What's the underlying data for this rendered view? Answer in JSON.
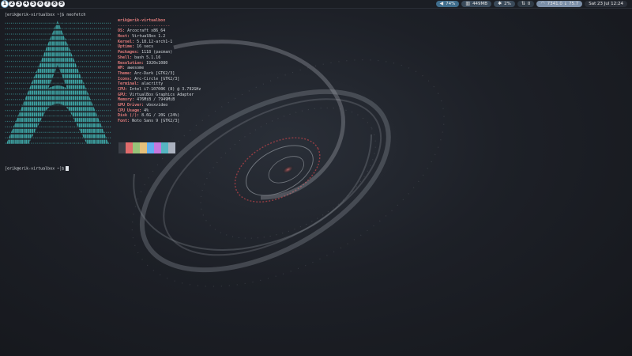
{
  "topbar": {
    "workspaces": [
      "1",
      "2",
      "3",
      "4",
      "5",
      "6",
      "7",
      "8",
      "9"
    ],
    "active_workspace": "1",
    "status": {
      "volume": "74%",
      "memory": "449MB",
      "cpu": "2%",
      "network": "0",
      "wifi": "7341.0 ↓ 75.7",
      "datetime": "Sat 23 Jul 12:24"
    }
  },
  "terminal": {
    "prompt1": "[erik@erik-virtualbox ~]$ neofetch",
    "prompt2": "[erik@erik-virtualbox ~]$",
    "user_host": "erik@erik-virtualbox",
    "separator": "----------------------",
    "info": [
      {
        "key": "OS",
        "value": "Arcocraft x86_64"
      },
      {
        "key": "Host",
        "value": "VirtualBox 1.2"
      },
      {
        "key": "Kernel",
        "value": "5.18.12-arch1-1"
      },
      {
        "key": "Uptime",
        "value": "16 secs"
      },
      {
        "key": "Packages",
        "value": "1118 (pacman)"
      },
      {
        "key": "Shell",
        "value": "bash 5.1.16"
      },
      {
        "key": "Resolution",
        "value": "1920x1080"
      },
      {
        "key": "WM",
        "value": "awesome"
      },
      {
        "key": "Theme",
        "value": "Arc-Dark [GTK2/3]"
      },
      {
        "key": "Icons",
        "value": "Arc-Circle [GTK2/3]"
      },
      {
        "key": "Terminal",
        "value": "alacritty"
      },
      {
        "key": "CPU",
        "value": "Intel i7-10700K (8) @ 3.792GHz"
      },
      {
        "key": "GPU",
        "value": "VirtualBox Graphics Adapter"
      },
      {
        "key": "Memory",
        "value": "476MiB / 7949MiB"
      },
      {
        "key": "GPU Driver",
        "value": "vboxvideo"
      },
      {
        "key": "CPU Usage",
        "value": "4%"
      },
      {
        "key": "Disk (/)",
        "value": "8.6G / 20G (24%)"
      },
      {
        "key": "Font",
        "value": "Noto Sans 9 [GTK2/3]"
      }
    ],
    "palette": [
      "#3b3f47",
      "#e06c6c",
      "#98c379",
      "#e5c07b",
      "#61afef",
      "#c678dd",
      "#56b6c2",
      "#abb2bf"
    ]
  },
  "colors": {
    "accent": "#3ea6a6",
    "key": "#e07a7a"
  }
}
